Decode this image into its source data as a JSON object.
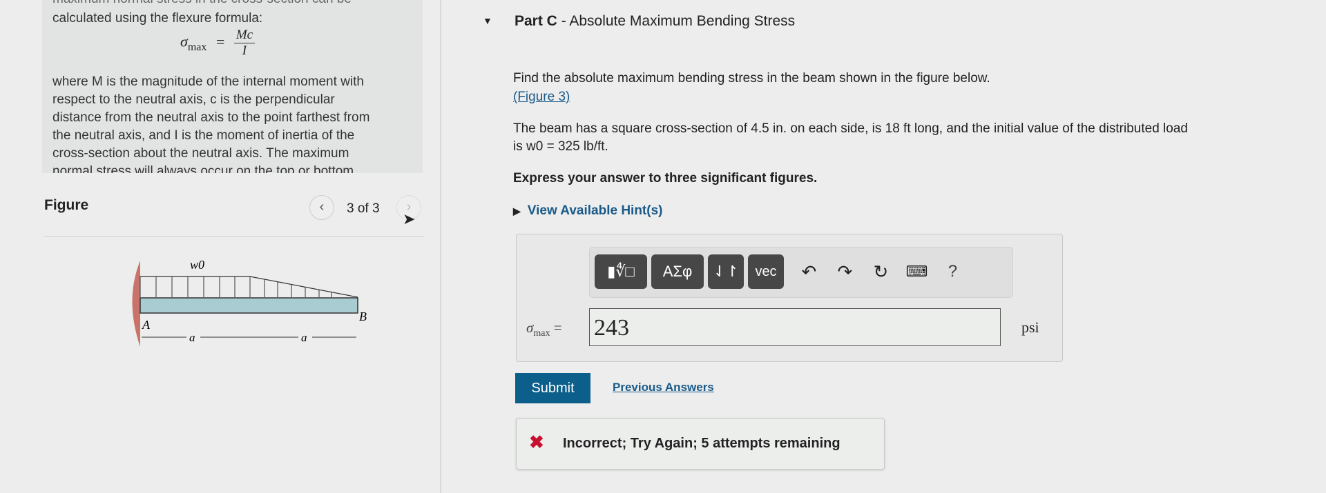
{
  "left": {
    "intro_partial": "maximum normal stress in the cross-section can be",
    "intro": "calculated using the flexure formula:",
    "formula": {
      "lhs": "σ",
      "sub": "max",
      "num": "Mc",
      "den": "I"
    },
    "paragraph": [
      "where M is the magnitude of the internal moment with",
      "respect to the neutral axis, c is the perpendicular",
      "distance from the neutral axis to the point farthest from",
      "the neutral axis, and I is the moment of inertia of the",
      "cross-section about the neutral axis. The maximum",
      "normal stress will always occur on the top or bottom"
    ]
  },
  "figure": {
    "title": "Figure",
    "pager": "3 of 3",
    "labels": {
      "load": "w0",
      "a1": "a",
      "a2": "a",
      "A": "A",
      "B": "B"
    }
  },
  "part": {
    "title_bold": "Part C",
    "title_rest": " - Absolute Maximum Bending Stress"
  },
  "problem": {
    "line1": "Find the absolute maximum bending stress in the beam shown in the figure below.",
    "figure_link": "(Figure 3)",
    "line2": "The beam has a square cross-section of 4.5 in. on each side, is 18 ft long, and the initial value of the distributed load",
    "line3": "is w0 = 325 lb/ft.",
    "instruction": "Express your answer to three significant figures.",
    "hints": "View Available Hint(s)"
  },
  "toolbar": {
    "templates": "▮∜□",
    "greek": "ΑΣφ",
    "arrows": "⇃↾",
    "vec": "vec",
    "help": "?"
  },
  "answer": {
    "label": "σ",
    "label_sub": "max",
    "equals": "=",
    "value": "243",
    "unit": "psi"
  },
  "actions": {
    "submit": "Submit",
    "previous": "Previous Answers"
  },
  "feedback": {
    "text": "Incorrect; Try Again; 5 attempts remaining",
    "color": "#c8102e"
  },
  "colors": {
    "submit": "#0b5f8a",
    "beam": "#a9cbd2",
    "wall": "#c9736a"
  }
}
